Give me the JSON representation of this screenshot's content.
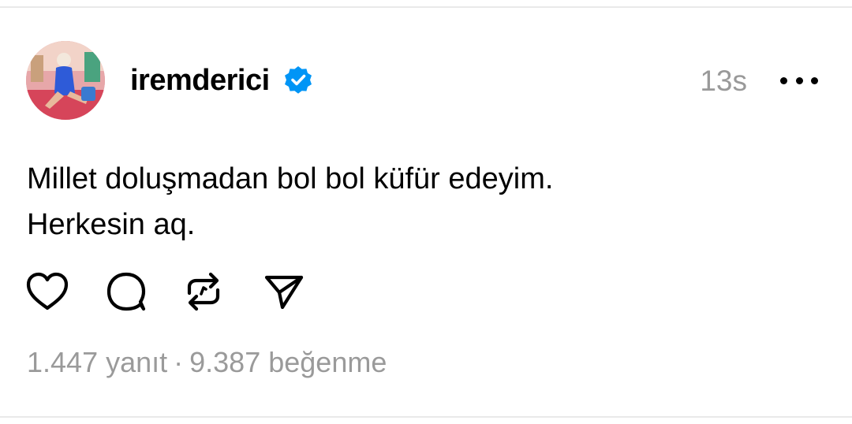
{
  "post": {
    "username": "iremderici",
    "timestamp": "13s",
    "lines": [
      "Millet doluşmadan bol bol küfür edeyim.",
      "Herkesin aq."
    ]
  },
  "icons": {
    "avatar": "user-avatar-photo",
    "verified": "verified-badge-icon",
    "more": "more-options-icon",
    "like": "heart-icon",
    "reply": "comment-bubble-icon",
    "repost": "repost-icon",
    "share": "send-icon"
  },
  "stats": {
    "replies": "1.447 yanıt",
    "separator": "·",
    "likes": "9.387 beğenme"
  },
  "colors": {
    "verified": "#0095f6",
    "muted": "#999999"
  }
}
